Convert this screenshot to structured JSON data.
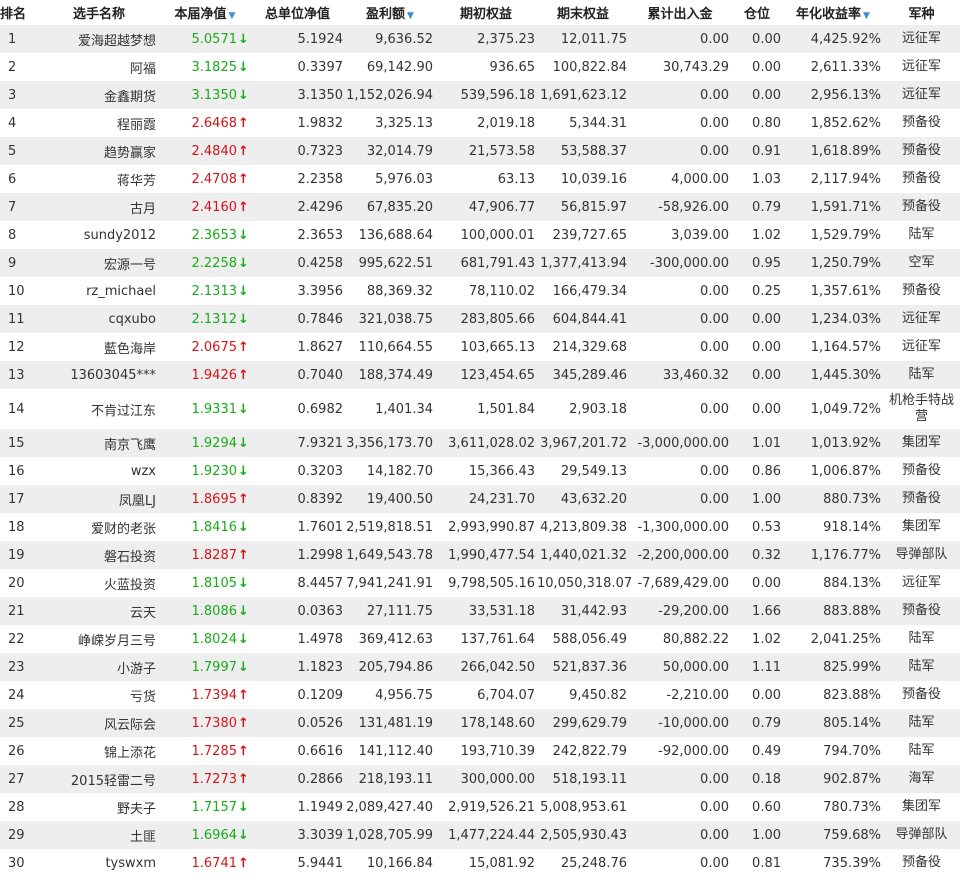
{
  "headers": {
    "rank": "排名",
    "name": "选手名称",
    "nav": "本届净值",
    "unit_nav": "总单位净值",
    "profit": "盈利额",
    "begin_equity": "期初权益",
    "end_equity": "期末权益",
    "cum_flow": "累计出入金",
    "position": "仓位",
    "annual": "年化收益率",
    "army": "军种"
  },
  "icons": {
    "sort": "sort-down-icon",
    "arrow_up": "arrow-up-icon",
    "arrow_down": "arrow-down-icon"
  },
  "colors": {
    "up": "#d4151a",
    "down": "#1aab1a",
    "sort": "#3a8fd6",
    "row_alt": "#eeeeee"
  },
  "rows": [
    {
      "rank": "1",
      "name": "爱海超越梦想",
      "nav": "5.0571",
      "dir": "down",
      "unit_nav": "5.1924",
      "profit": "9,636.52",
      "begin_equity": "2,375.23",
      "end_equity": "12,011.75",
      "cum_flow": "0.00",
      "position": "0.00",
      "annual": "4,425.92%",
      "army": "远征军"
    },
    {
      "rank": "2",
      "name": "阿福",
      "nav": "3.1825",
      "dir": "down",
      "unit_nav": "0.3397",
      "profit": "69,142.90",
      "begin_equity": "936.65",
      "end_equity": "100,822.84",
      "cum_flow": "30,743.29",
      "position": "0.00",
      "annual": "2,611.33%",
      "army": "远征军"
    },
    {
      "rank": "3",
      "name": "金鑫期货",
      "nav": "3.1350",
      "dir": "down",
      "unit_nav": "3.1350",
      "profit": "1,152,026.94",
      "begin_equity": "539,596.18",
      "end_equity": "1,691,623.12",
      "cum_flow": "0.00",
      "position": "0.00",
      "annual": "2,956.13%",
      "army": "远征军"
    },
    {
      "rank": "4",
      "name": "程丽霞",
      "nav": "2.6468",
      "dir": "up",
      "unit_nav": "1.9832",
      "profit": "3,325.13",
      "begin_equity": "2,019.18",
      "end_equity": "5,344.31",
      "cum_flow": "0.00",
      "position": "0.80",
      "annual": "1,852.62%",
      "army": "预备役"
    },
    {
      "rank": "5",
      "name": "趋势赢家",
      "nav": "2.4840",
      "dir": "up",
      "unit_nav": "0.7323",
      "profit": "32,014.79",
      "begin_equity": "21,573.58",
      "end_equity": "53,588.37",
      "cum_flow": "0.00",
      "position": "0.91",
      "annual": "1,618.89%",
      "army": "预备役"
    },
    {
      "rank": "6",
      "name": "蒋华芳",
      "nav": "2.4708",
      "dir": "up",
      "unit_nav": "2.2358",
      "profit": "5,976.03",
      "begin_equity": "63.13",
      "end_equity": "10,039.16",
      "cum_flow": "4,000.00",
      "position": "1.03",
      "annual": "2,117.94%",
      "army": "预备役"
    },
    {
      "rank": "7",
      "name": "古月",
      "nav": "2.4160",
      "dir": "up",
      "unit_nav": "2.4296",
      "profit": "67,835.20",
      "begin_equity": "47,906.77",
      "end_equity": "56,815.97",
      "cum_flow": "-58,926.00",
      "position": "0.79",
      "annual": "1,591.71%",
      "army": "预备役"
    },
    {
      "rank": "8",
      "name": "sundy2012",
      "nav": "2.3653",
      "dir": "down",
      "unit_nav": "2.3653",
      "profit": "136,688.64",
      "begin_equity": "100,000.01",
      "end_equity": "239,727.65",
      "cum_flow": "3,039.00",
      "position": "1.02",
      "annual": "1,529.79%",
      "army": "陆军"
    },
    {
      "rank": "9",
      "name": "宏源一号",
      "nav": "2.2258",
      "dir": "down",
      "unit_nav": "0.4258",
      "profit": "995,622.51",
      "begin_equity": "681,791.43",
      "end_equity": "1,377,413.94",
      "cum_flow": "-300,000.00",
      "position": "0.95",
      "annual": "1,250.79%",
      "army": "空军"
    },
    {
      "rank": "10",
      "name": "rz_michael",
      "nav": "2.1313",
      "dir": "down",
      "unit_nav": "3.3956",
      "profit": "88,369.32",
      "begin_equity": "78,110.02",
      "end_equity": "166,479.34",
      "cum_flow": "0.00",
      "position": "0.25",
      "annual": "1,357.61%",
      "army": "预备役"
    },
    {
      "rank": "11",
      "name": "cqxubo",
      "nav": "2.1312",
      "dir": "down",
      "unit_nav": "0.7846",
      "profit": "321,038.75",
      "begin_equity": "283,805.66",
      "end_equity": "604,844.41",
      "cum_flow": "0.00",
      "position": "0.00",
      "annual": "1,234.03%",
      "army": "远征军"
    },
    {
      "rank": "12",
      "name": "藍色海岸",
      "nav": "2.0675",
      "dir": "up",
      "unit_nav": "1.8627",
      "profit": "110,664.55",
      "begin_equity": "103,665.13",
      "end_equity": "214,329.68",
      "cum_flow": "0.00",
      "position": "0.00",
      "annual": "1,164.57%",
      "army": "远征军"
    },
    {
      "rank": "13",
      "name": "13603045***",
      "nav": "1.9426",
      "dir": "up",
      "unit_nav": "0.7040",
      "profit": "188,374.49",
      "begin_equity": "123,454.65",
      "end_equity": "345,289.46",
      "cum_flow": "33,460.32",
      "position": "0.00",
      "annual": "1,445.30%",
      "army": "陆军"
    },
    {
      "rank": "14",
      "name": "不肯过江东",
      "nav": "1.9331",
      "dir": "down",
      "unit_nav": "0.6982",
      "profit": "1,401.34",
      "begin_equity": "1,501.84",
      "end_equity": "2,903.18",
      "cum_flow": "0.00",
      "position": "0.00",
      "annual": "1,049.72%",
      "army": "机枪手特战营",
      "tall": true
    },
    {
      "rank": "15",
      "name": "南京飞鹰",
      "nav": "1.9294",
      "dir": "down",
      "unit_nav": "7.9321",
      "profit": "3,356,173.70",
      "begin_equity": "3,611,028.02",
      "end_equity": "3,967,201.72",
      "cum_flow": "-3,000,000.00",
      "position": "1.01",
      "annual": "1,013.92%",
      "army": "集团军"
    },
    {
      "rank": "16",
      "name": "wzx",
      "nav": "1.9230",
      "dir": "down",
      "unit_nav": "0.3203",
      "profit": "14,182.70",
      "begin_equity": "15,366.43",
      "end_equity": "29,549.13",
      "cum_flow": "0.00",
      "position": "0.86",
      "annual": "1,006.87%",
      "army": "预备役"
    },
    {
      "rank": "17",
      "name": "凤凰LJ",
      "nav": "1.8695",
      "dir": "up",
      "unit_nav": "0.8392",
      "profit": "19,400.50",
      "begin_equity": "24,231.70",
      "end_equity": "43,632.20",
      "cum_flow": "0.00",
      "position": "1.00",
      "annual": "880.73%",
      "army": "预备役"
    },
    {
      "rank": "18",
      "name": "爱财的老张",
      "nav": "1.8416",
      "dir": "down",
      "unit_nav": "1.7601",
      "profit": "2,519,818.51",
      "begin_equity": "2,993,990.87",
      "end_equity": "4,213,809.38",
      "cum_flow": "-1,300,000.00",
      "position": "0.53",
      "annual": "918.14%",
      "army": "集团军"
    },
    {
      "rank": "19",
      "name": "磐石投资",
      "nav": "1.8287",
      "dir": "up",
      "unit_nav": "1.2998",
      "profit": "1,649,543.78",
      "begin_equity": "1,990,477.54",
      "end_equity": "1,440,021.32",
      "cum_flow": "-2,200,000.00",
      "position": "0.32",
      "annual": "1,176.77%",
      "army": "导弹部队"
    },
    {
      "rank": "20",
      "name": "火蓝投资",
      "nav": "1.8105",
      "dir": "down",
      "unit_nav": "8.4457",
      "profit": "7,941,241.91",
      "begin_equity": "9,798,505.16",
      "end_equity": "10,050,318.07",
      "cum_flow": "-7,689,429.00",
      "position": "0.00",
      "annual": "884.13%",
      "army": "远征军"
    },
    {
      "rank": "21",
      "name": "云天",
      "nav": "1.8086",
      "dir": "down",
      "unit_nav": "0.0363",
      "profit": "27,111.75",
      "begin_equity": "33,531.18",
      "end_equity": "31,442.93",
      "cum_flow": "-29,200.00",
      "position": "1.66",
      "annual": "883.88%",
      "army": "预备役"
    },
    {
      "rank": "22",
      "name": "峥嵘岁月三号",
      "nav": "1.8024",
      "dir": "down",
      "unit_nav": "1.4978",
      "profit": "369,412.63",
      "begin_equity": "137,761.64",
      "end_equity": "588,056.49",
      "cum_flow": "80,882.22",
      "position": "1.02",
      "annual": "2,041.25%",
      "army": "陆军"
    },
    {
      "rank": "23",
      "name": "小游子",
      "nav": "1.7997",
      "dir": "down",
      "unit_nav": "1.1823",
      "profit": "205,794.86",
      "begin_equity": "266,042.50",
      "end_equity": "521,837.36",
      "cum_flow": "50,000.00",
      "position": "1.11",
      "annual": "825.99%",
      "army": "陆军"
    },
    {
      "rank": "24",
      "name": "亏货",
      "nav": "1.7394",
      "dir": "up",
      "unit_nav": "0.1209",
      "profit": "4,956.75",
      "begin_equity": "6,704.07",
      "end_equity": "9,450.82",
      "cum_flow": "-2,210.00",
      "position": "0.00",
      "annual": "823.88%",
      "army": "预备役"
    },
    {
      "rank": "25",
      "name": "风云际会",
      "nav": "1.7380",
      "dir": "up",
      "unit_nav": "0.0526",
      "profit": "131,481.19",
      "begin_equity": "178,148.60",
      "end_equity": "299,629.79",
      "cum_flow": "-10,000.00",
      "position": "0.79",
      "annual": "805.14%",
      "army": "陆军"
    },
    {
      "rank": "26",
      "name": "锦上添花",
      "nav": "1.7285",
      "dir": "up",
      "unit_nav": "0.6616",
      "profit": "141,112.40",
      "begin_equity": "193,710.39",
      "end_equity": "242,822.79",
      "cum_flow": "-92,000.00",
      "position": "0.49",
      "annual": "794.70%",
      "army": "陆军"
    },
    {
      "rank": "27",
      "name": "2015轻雷二号",
      "nav": "1.7273",
      "dir": "up",
      "unit_nav": "0.2866",
      "profit": "218,193.11",
      "begin_equity": "300,000.00",
      "end_equity": "518,193.11",
      "cum_flow": "0.00",
      "position": "0.18",
      "annual": "902.87%",
      "army": "海军"
    },
    {
      "rank": "28",
      "name": "野夫子",
      "nav": "1.7157",
      "dir": "down",
      "unit_nav": "1.1949",
      "profit": "2,089,427.40",
      "begin_equity": "2,919,526.21",
      "end_equity": "5,008,953.61",
      "cum_flow": "0.00",
      "position": "0.60",
      "annual": "780.73%",
      "army": "集团军"
    },
    {
      "rank": "29",
      "name": "土匪",
      "nav": "1.6964",
      "dir": "down",
      "unit_nav": "3.3039",
      "profit": "1,028,705.99",
      "begin_equity": "1,477,224.44",
      "end_equity": "2,505,930.43",
      "cum_flow": "0.00",
      "position": "1.00",
      "annual": "759.68%",
      "army": "导弹部队"
    },
    {
      "rank": "30",
      "name": "tyswxm",
      "nav": "1.6741",
      "dir": "up",
      "unit_nav": "5.9441",
      "profit": "10,166.84",
      "begin_equity": "15,081.92",
      "end_equity": "25,248.76",
      "cum_flow": "0.00",
      "position": "0.81",
      "annual": "735.39%",
      "army": "预备役"
    }
  ]
}
